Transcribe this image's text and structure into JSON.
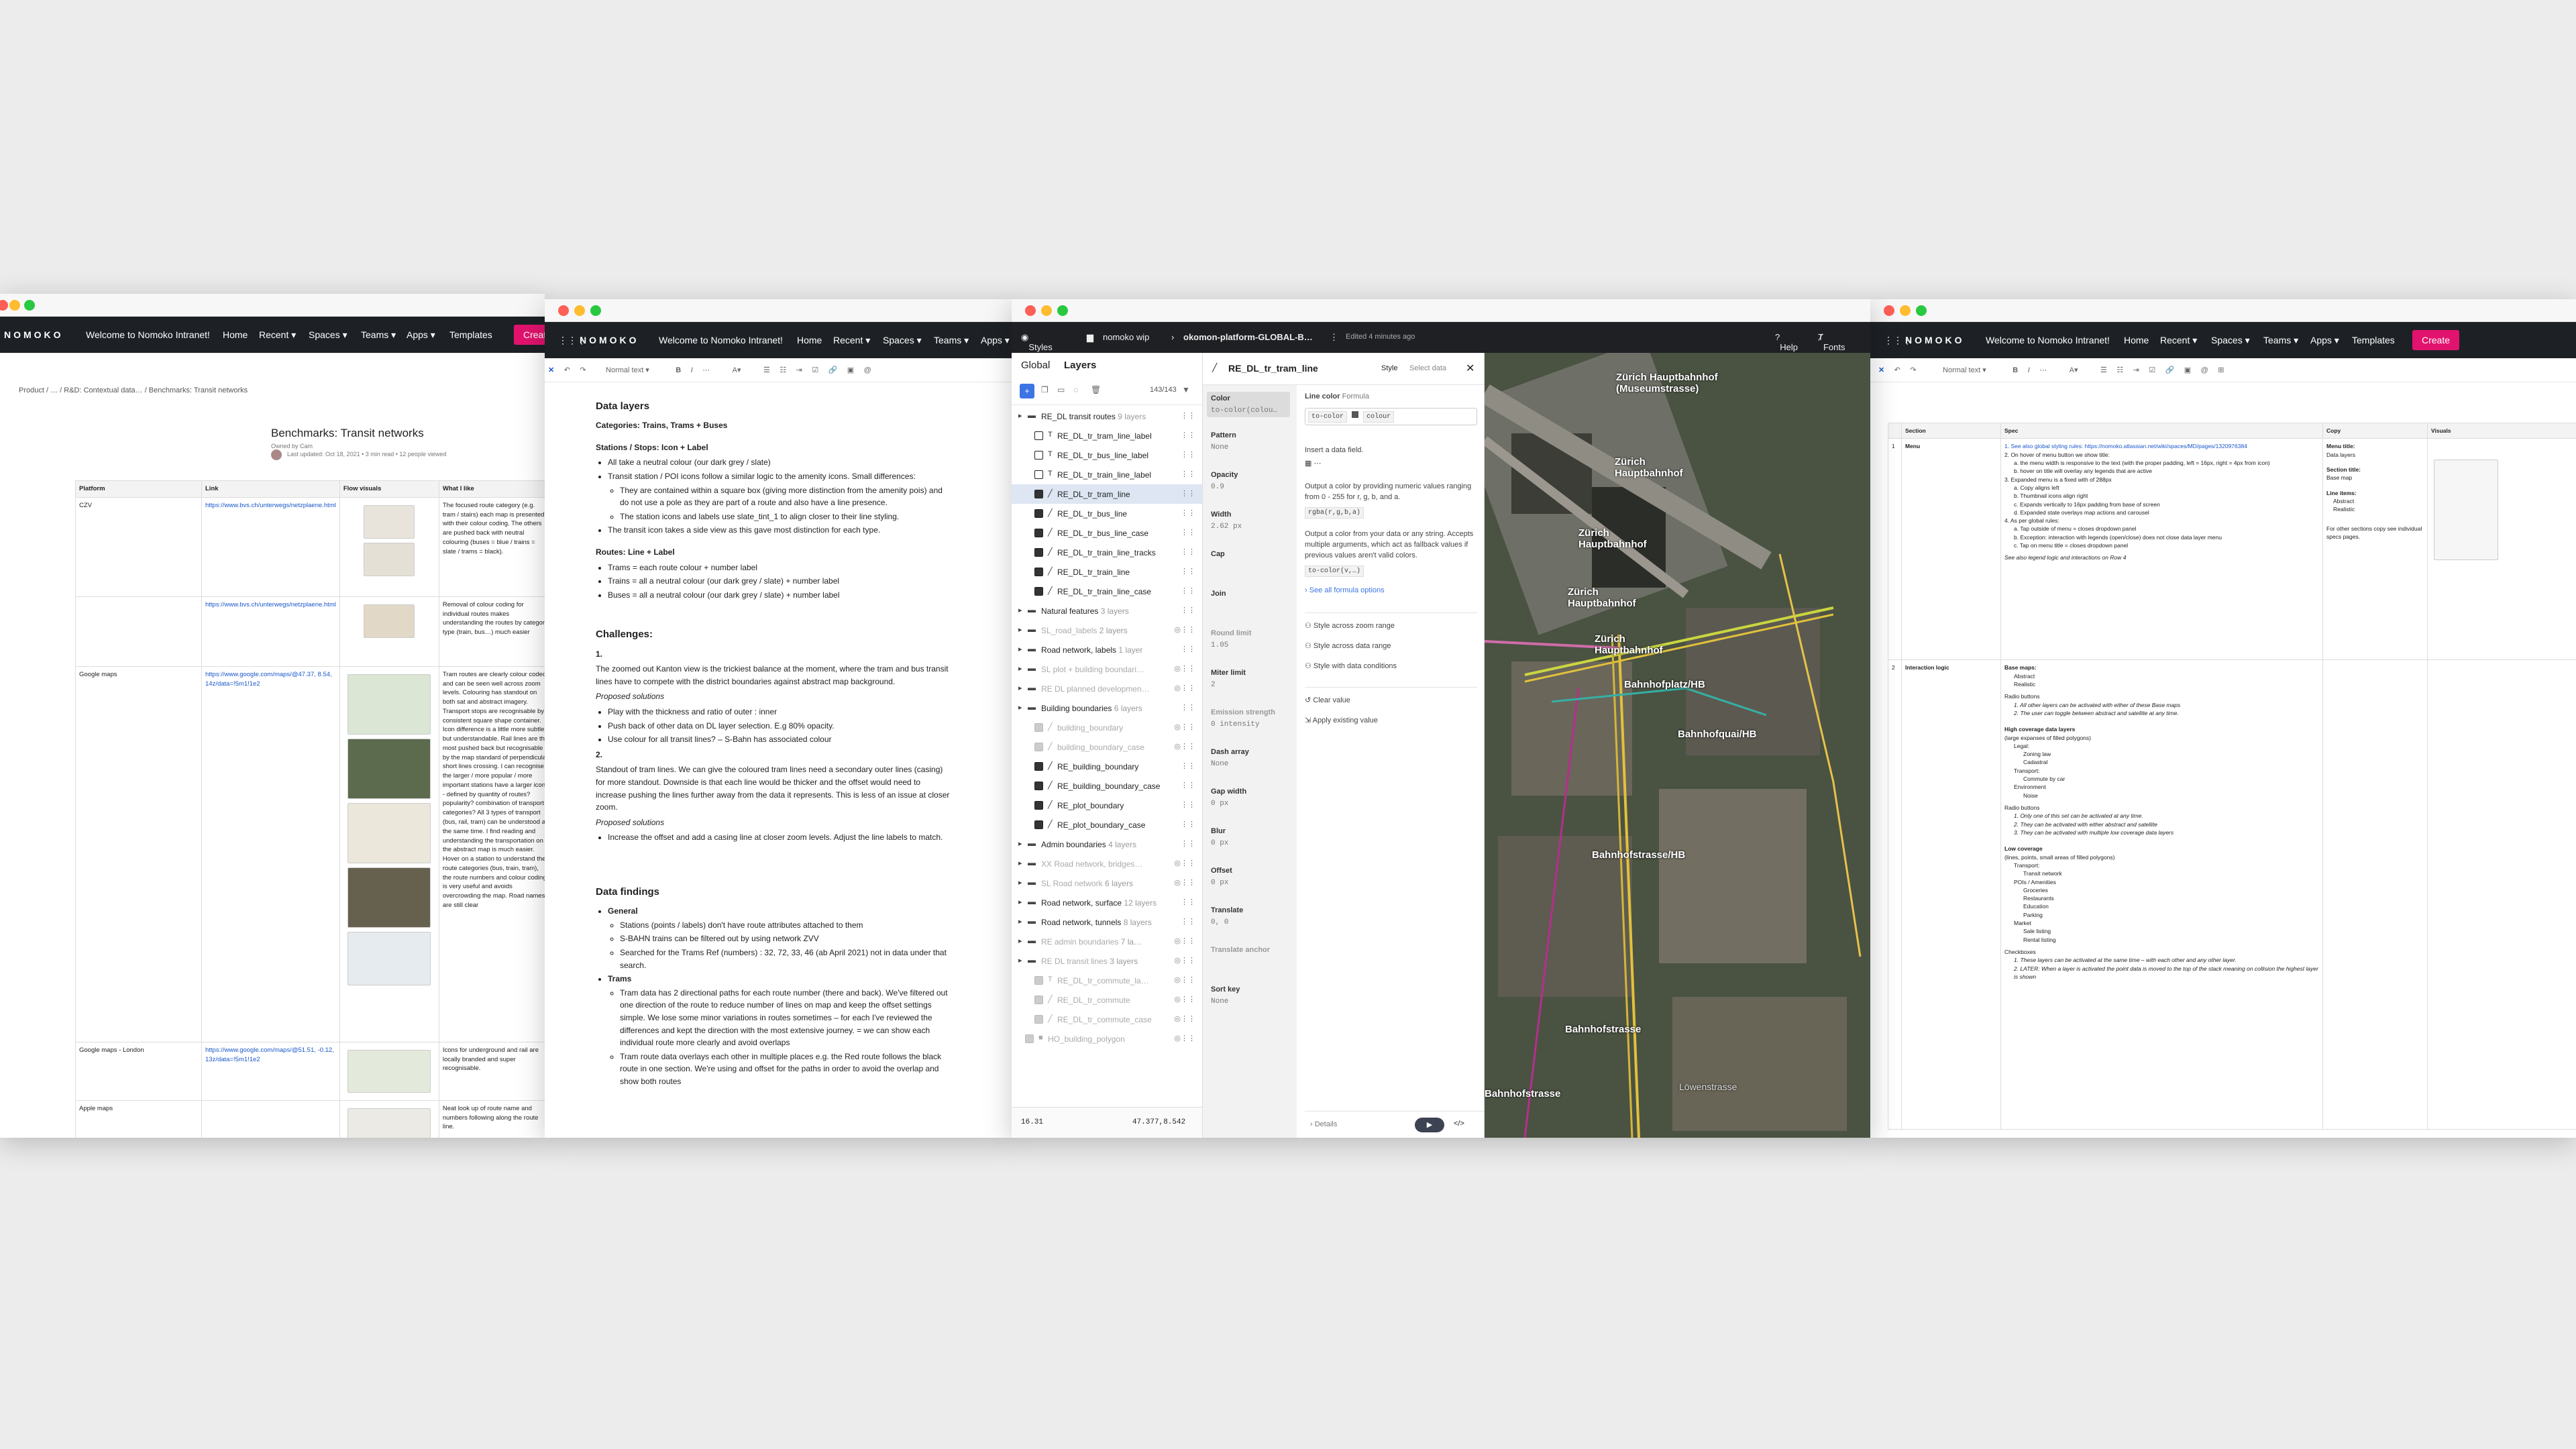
{
  "intranet": {
    "brand": "NOMOKO",
    "nav": [
      "Welcome to Nomoko Intranet!",
      "Home",
      "Recent ▾",
      "Spaces ▾",
      "Teams ▾",
      "Apps ▾",
      "Templates"
    ],
    "create": "Create"
  },
  "win1": {
    "breadcrumb": "Product  /  …  /  R&D: Contextual data…  /  Benchmarks: Transit networks",
    "title": "Benchmarks: Transit networks",
    "owner": "Owned by Cam",
    "meta": "Last updated: Oct 18, 2021 • 3 min read • 12 people viewed",
    "headers": [
      "Platform",
      "Link",
      "Flow visuals",
      "What I like"
    ],
    "rows": [
      {
        "platform": "CZV",
        "link": "https://www.bvs.ch/unterwegs/netzplaene.html",
        "like": "The focused route category (e.g. tram / stairs) each map is presented with their colour coding. The others are pushed back with neutral colouring (buses = blue / trains = slate / trams = black)."
      },
      {
        "platform": "",
        "link": "https://www.bvs.ch/unterwegs/netzplaene.html",
        "like": "Removal of colour coding for individual routes makes understanding the routes by category type (train, bus…) much easier"
      },
      {
        "platform": "Google maps",
        "link": "https://www.google.com/maps/@47.37, 8.54, 14z/data=!5m1!1e2",
        "like": "Tram routes are clearly colour coded and can be seen well across zoom levels. Colouring has standout on both sat and abstract imagery. Transport stops are recognisable by consistent square shape container. Icon difference is a little more subtle but understandable. Rail lines are the most pushed back but recognisable by the map standard of perpendicular short lines crossing. I can recognise the larger / more popular / more important stations have a larger icon - defined by quantity of routes? popularity? combination of transport categories? All 3 types of transport (bus, rail, tram) can be understood at the same time. I find reading and understanding the transportation on the abstract map is much easier. Hover on a station to understand the route categories (bus, train, tram), the route numbers and colour coding is very useful and avoids overcrowding the map. Road names are still clear"
      },
      {
        "platform": "Google maps - London",
        "link": "https://www.google.com/maps/@51.51, -0.12, 13z/data=!5m1!1e2",
        "like": "Icons for underground and rail are locally branded and super recognisable."
      },
      {
        "platform": "Apple maps",
        "link": "",
        "like": "Neat look up of route name and numbers following along the route line."
      }
    ]
  },
  "win2": {
    "toolbar": "Normal text ▾",
    "h_data_layers": "Data layers",
    "categories": "Categories: Trains, Trams + Buses",
    "stations_title": "Stations / Stops: Icon + Label",
    "stations": [
      "All take a neutral colour (our dark grey / slate)",
      "Transit station / POI icons follow a similar logic to the amenity icons. Small differences:",
      "They are contained within a square box (giving more distinction from the amenity pois) and do not use a pole as they are part of a route and also have a line presence.",
      "The station icons and labels use slate_tint_1 to align closer to their line styling.",
      "The transit icon takes a side view as this gave most distinction for each type."
    ],
    "routes_title": "Routes: Line + Label",
    "routes": [
      "Trams = each route colour + number label",
      "Trains = all a neutral colour (our dark grey / slate) + number label",
      "Buses = all a neutral colour (our dark grey / slate) + number label"
    ],
    "h_challenges": "Challenges:",
    "c1_num": "1.",
    "c1_text": "The zoomed out Kanton view is the trickiest balance at the moment, where the tram and bus transit lines have to compete with the district boundaries against abstract map background.",
    "c1_sol_title": "Proposed solutions",
    "c1_solutions": [
      "Play with the thickness and ratio of outer : inner",
      "Push back of other data on DL layer selection. E.g 80% opacity.",
      "Use colour for all transit lines? – S-Bahn has associated colour"
    ],
    "c2_num": "2.",
    "c2_text": "Standout of tram lines. We can give the coloured tram lines need a secondary outer lines (casing) for more standout. Downside is that each line would be thicker and the offset would need to increase pushing the lines further away from the data it represents. This is less of an issue at closer zoom.",
    "c2_sol_title": "Proposed solutions",
    "c2_solutions": [
      "Increase the offset and add a casing line at closer zoom levels. Adjust the line labels to match."
    ],
    "h_findings": "Data findings",
    "f_general": "General",
    "f_general_items": [
      "Stations (points / labels) don't have route attributes attached to them",
      "S-BAHN trains can be filtered out by using network ZVV",
      "Searched for the Trams Ref (numbers) : 32, 72, 33, 46 (ab April 2021) not in data under that search."
    ],
    "f_trams": "Trams",
    "f_trams_items": [
      "Tram data has 2 directional paths for each route number (there and back). We've filtered out one direction of the route to reduce number of lines on map and keep the offset settings simple. We lose some minor variations in routes sometimes – for each I've reviewed the differences and kept the direction with the most extensive journey. = we can show each individual route more clearly and avoid overlaps",
      "Tram route data overlays each other in multiple places e.g. the Red route follows the black route in one section. We're using and offset for the paths in order to avoid the overlap and show both routes"
    ]
  },
  "mapbox": {
    "styles": "Styles",
    "project": "nomoko wip",
    "style_name": "okomon-platform-GLOBAL-B…",
    "edited": "Edited 4 minutes ago",
    "help": "Help",
    "fonts": "Fonts",
    "tab_global": "Global",
    "tab_layers": "Layers",
    "layer_count": "143/143",
    "layers": [
      {
        "name": "RE_DL transit routes",
        "count": "9 layers",
        "type": "group",
        "indent": 0
      },
      {
        "name": "RE_DL_tr_tram_line_label",
        "type": "text",
        "indent": 1
      },
      {
        "name": "RE_DL_tr_bus_line_label",
        "type": "text",
        "indent": 1
      },
      {
        "name": "RE_DL_tr_train_line_label",
        "type": "text",
        "indent": 1
      },
      {
        "name": "RE_DL_tr_tram_line",
        "type": "line",
        "indent": 1,
        "selected": true
      },
      {
        "name": "RE_DL_tr_bus_line",
        "type": "line",
        "indent": 1
      },
      {
        "name": "RE_DL_tr_bus_line_case",
        "type": "line",
        "indent": 1
      },
      {
        "name": "RE_DL_tr_train_line_tracks",
        "type": "line",
        "indent": 1
      },
      {
        "name": "RE_DL_tr_train_line",
        "type": "line",
        "indent": 1
      },
      {
        "name": "RE_DL_tr_train_line_case",
        "type": "line",
        "indent": 1
      },
      {
        "name": "Natural features",
        "count": "3 layers",
        "type": "group",
        "indent": 0
      },
      {
        "name": "SL_road_labels",
        "count": "2 layers",
        "type": "group",
        "indent": 0,
        "dim": true
      },
      {
        "name": "Road network, labels",
        "count": "1 layer",
        "type": "group",
        "indent": 0
      },
      {
        "name": "SL plot + building boundari…",
        "type": "group",
        "indent": 0,
        "dim": true
      },
      {
        "name": "RE DL planned developmen…",
        "type": "group",
        "indent": 0,
        "dim": true
      },
      {
        "name": "Building boundaries",
        "count": "6 layers",
        "type": "group",
        "indent": 0
      },
      {
        "name": "building_boundary",
        "type": "line",
        "indent": 1,
        "dim": true
      },
      {
        "name": "building_boundary_case",
        "type": "line",
        "indent": 1,
        "dim": true
      },
      {
        "name": "RE_building_boundary",
        "type": "line",
        "indent": 1
      },
      {
        "name": "RE_building_boundary_case",
        "type": "line",
        "indent": 1
      },
      {
        "name": "RE_plot_boundary",
        "type": "line",
        "indent": 1
      },
      {
        "name": "RE_plot_boundary_case",
        "type": "line",
        "indent": 1
      },
      {
        "name": "Admin boundaries",
        "count": "4 layers",
        "type": "group",
        "indent": 0
      },
      {
        "name": "XX Road network, bridges…",
        "type": "group",
        "indent": 0,
        "dim": true
      },
      {
        "name": "SL Road network",
        "count": "6 layers",
        "type": "group",
        "indent": 0,
        "dim": true
      },
      {
        "name": "Road network, surface",
        "count": "12 layers",
        "type": "group",
        "indent": 0
      },
      {
        "name": "Road network, tunnels",
        "count": "8 layers",
        "type": "group",
        "indent": 0
      },
      {
        "name": "RE admin boundaries",
        "count": "7 la…",
        "type": "group",
        "indent": 0,
        "dim": true
      },
      {
        "name": "RE DL transit lines",
        "count": "3 layers",
        "type": "group",
        "indent": 0,
        "dim": true
      },
      {
        "name": "RE_DL_tr_commute_la…",
        "type": "text",
        "indent": 1,
        "dim": true
      },
      {
        "name": "RE_DL_tr_commute",
        "type": "line",
        "indent": 1,
        "dim": true
      },
      {
        "name": "RE_DL_tr_commute_case",
        "type": "line",
        "indent": 1,
        "dim": true
      },
      {
        "name": "HO_building_polygon",
        "type": "fill",
        "indent": 0,
        "dim": true
      }
    ],
    "zoom": "16.31",
    "coords": "47.377,8.542",
    "layer_title": "RE_DL_tr_tram_line",
    "tab_style": "Style",
    "tab_select": "Select data",
    "props": [
      {
        "label": "Color",
        "value": "to-color(colou…"
      },
      {
        "label": "Pattern",
        "value": "None"
      },
      {
        "label": "Opacity",
        "value": "0.9"
      },
      {
        "label": "Width",
        "value": "2.62 px"
      },
      {
        "label": "Cap",
        "value": ""
      },
      {
        "label": "Join",
        "value": ""
      },
      {
        "label": "Round limit",
        "value": "1.05"
      },
      {
        "label": "Miter limit",
        "value": "2"
      },
      {
        "label": "Emission strength",
        "value": "0 intensity"
      },
      {
        "label": "Dash array",
        "value": "None"
      },
      {
        "label": "Gap width",
        "value": "0 px"
      },
      {
        "label": "Blur",
        "value": "0 px"
      },
      {
        "label": "Offset",
        "value": "0 px"
      },
      {
        "label": "Translate",
        "value": "0, 0"
      },
      {
        "label": "Translate anchor",
        "value": ""
      },
      {
        "label": "Sort key",
        "value": "None"
      }
    ],
    "line_color_title": "Line color",
    "formula": "Formula",
    "expr1": "to-color",
    "expr2": "colour",
    "insert_field": "Insert a data field.",
    "rgba_help": "Output a color by providing numeric values ranging from 0 - 255 for r, g, b, and a.",
    "rgba_expr": "rgba(r,g,b,a)",
    "tocolor_help": "Output a color from your data or any string. Accepts multiple arguments, which act as fallback values if previous values aren't valid colors.",
    "tocolor_expr": "to-color(v,…)",
    "see_all": "See all formula options",
    "opt_zoom": "Style across zoom range",
    "opt_data": "Style across data range",
    "opt_cond": "Style with data conditions",
    "clear": "Clear value",
    "apply_existing": "Apply existing value",
    "details": "Details",
    "map_labels": [
      "Zürich Hauptbahnhof",
      "Zürich Hauptbahnhof",
      "Zürich Hauptbahnhof",
      "Zürich Hauptbahnhof",
      "Bahnhofplatz/HB",
      "Bahnhofquai/HB",
      "Bahnhofstrasse/HB",
      "Bahnhofstrasse",
      "Bahnhofstrasse",
      "Zürich Hauptbahnhof (Museumstrasse)",
      "Löwenstrasse"
    ]
  },
  "win4": {
    "headers": [
      "Section",
      "Spec",
      "Copy",
      "Visuals"
    ],
    "row1_section": "Menu",
    "row1_spec": [
      "1. See also global styling rules: https://nomoko.atlassian.net/wiki/spaces/MD/pages/1320976384",
      "2. On hover of menu button we show title:",
      "a. the menu width is responsive to the text (with the proper padding, left = 16px, right = 4px from icon)",
      "b. hover on title will overlay any legends that are active",
      "3. Expanded menu is a fixed with of 288px",
      "a. Copy aligns left",
      "b. Thumbnail icons align right",
      "c. Expands vertically to 16px padding from base of screen",
      "d. Expanded state overlays map actions and carousel",
      "4. As per global rules:",
      "a. Tap outside of menu = closes dropdown panel",
      "b. Exception: interaction with legends (open/close) does not close data layer menu",
      "c. Tap on menu title = closes dropdown panel",
      "See also legend logic and interactions on Row 4"
    ],
    "row1_copy": [
      "Menu title:",
      "Data layers",
      "Section title:",
      "Base map",
      "Line items:",
      "Abstract",
      "Realistic",
      "For other sections copy see individual specs pages."
    ],
    "row2_section": "Interaction logic",
    "row2_spec": [
      "Base maps:",
      "Abstract",
      "Realistic",
      "Radio buttons",
      "1. All other layers can be activated with either of these Base maps",
      "2. The user can toggle between abstract and satellite at any time.",
      "High coverage data layers",
      "(large expanses of filled polygons)",
      "Legal:",
      "Zoning law",
      "Cadastral",
      "Transport:",
      "Commute by car",
      "Environment",
      "Noise",
      "Radio buttons",
      "1. Only one of this set can be activated at any time.",
      "2. They can be activated with either abstract and satellite",
      "3. They can be activated with multiple low coverage data layers",
      "Low coverage",
      "(lines, points, small areas of filled polygons)",
      "Transport:",
      "Transit network",
      "POIs / Amenities",
      "Groceries",
      "Restaurants",
      "Education",
      "Parking",
      "Market",
      "Sale listing",
      "Rental listing",
      "Checkboxes",
      "1. These layers can be activated at the same time – with each other and any other layer.",
      "2. LATER: When a layer is activated the point data is moved to the top of the stack meaning on collision the highest layer is shown"
    ],
    "row_num1": "1",
    "row_num2": "2"
  }
}
